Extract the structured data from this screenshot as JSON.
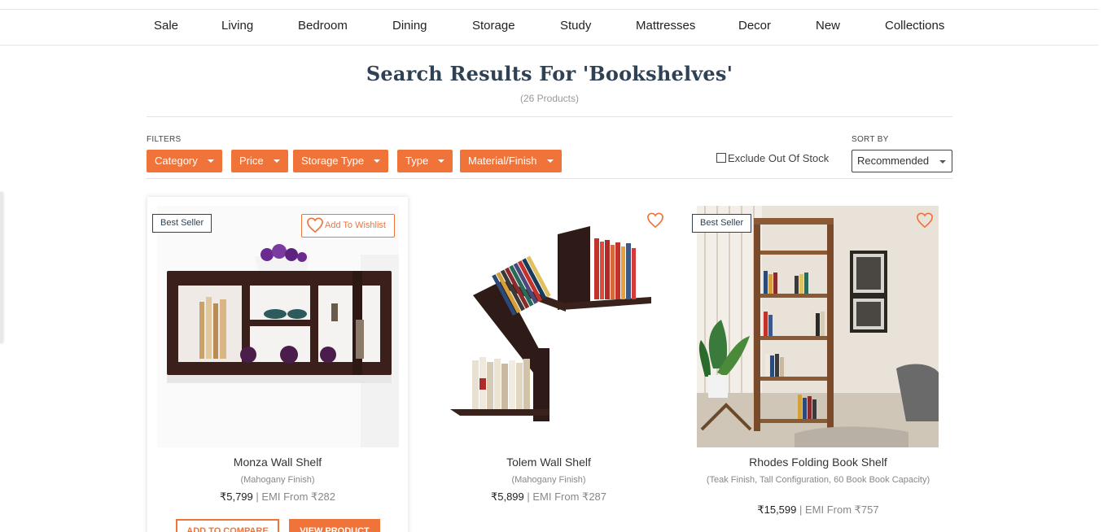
{
  "nav": {
    "items": [
      "Sale",
      "Living",
      "Bedroom",
      "Dining",
      "Storage",
      "Study",
      "Mattresses",
      "Decor",
      "New",
      "Collections"
    ]
  },
  "search": {
    "title": "Search Results For 'Bookshelves'",
    "count": "(26 Products)"
  },
  "filters": {
    "label": "FILTERS",
    "buttons": [
      "Category",
      "Price",
      "Storage Type",
      "Type",
      "Material/Finish"
    ],
    "exclude_label": "Exclude Out Of Stock",
    "exclude_checked": false
  },
  "sort": {
    "label": "SORT BY",
    "selected": "Recommended"
  },
  "colors": {
    "accent": "#f0743a",
    "heading": "#2f4154"
  },
  "products": [
    {
      "name": "Monza Wall Shelf",
      "finish": "(Mahogany Finish)",
      "price": "₹5,799",
      "emi": "EMI From ₹282",
      "badge": "Best Seller",
      "wishlist_label": "Add To Wishlist",
      "compare_label": "ADD TO COMPARE",
      "view_label": "VIEW PRODUCT"
    },
    {
      "name": "Tolem Wall Shelf",
      "finish": "(Mahogany Finish)",
      "price": "₹5,899",
      "emi": "EMI From ₹287"
    },
    {
      "name": "Rhodes Folding Book Shelf",
      "finish": "(Teak Finish, Tall Configuration, 60 Book Book Capacity)",
      "price": "₹15,599",
      "emi": "EMI From ₹757",
      "badge": "Best Seller"
    }
  ]
}
